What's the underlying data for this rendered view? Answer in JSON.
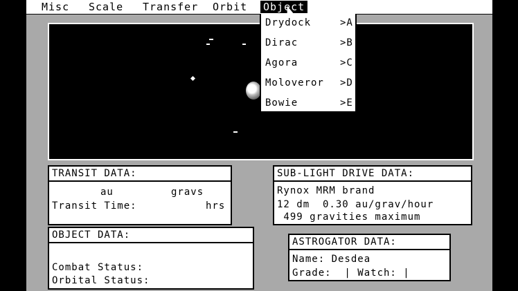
{
  "menu": {
    "items": [
      {
        "label": "Misc"
      },
      {
        "label": "Scale"
      },
      {
        "label": "Transfer"
      },
      {
        "label": "Orbit"
      },
      {
        "label": "Object"
      }
    ]
  },
  "dropdown": {
    "items": [
      {
        "label": "Drydock",
        "key": ">A"
      },
      {
        "label": "Dirac",
        "key": ">B"
      },
      {
        "label": "Agora",
        "key": ">C"
      },
      {
        "label": "Moloveror",
        "key": ">D"
      },
      {
        "label": "Bowie",
        "key": ">E"
      }
    ]
  },
  "transit": {
    "title": "TRANSIT DATA:",
    "unit_au": "au",
    "unit_gravs": "gravs",
    "time_label": "Transit Time:",
    "unit_hrs": "hrs"
  },
  "sublight": {
    "title": "SUB-LIGHT DRIVE DATA:",
    "line1": "Rynox MRM brand",
    "line2": "12 dm  0.30 au/grav/hour",
    "line3": " 499 gravities maximum"
  },
  "object_data": {
    "title": "OBJECT DATA:",
    "combat_label": "Combat Status:",
    "orbital_label": "Orbital Status:"
  },
  "astrogator": {
    "title": "ASTROGATOR DATA:",
    "name_line": "Name: Desdea",
    "grade_line": "Grade:  | Watch: |"
  },
  "colors": {
    "background": "#000000",
    "screen": "#a9a9a9",
    "panel": "#ffffff",
    "text": "#000000"
  }
}
